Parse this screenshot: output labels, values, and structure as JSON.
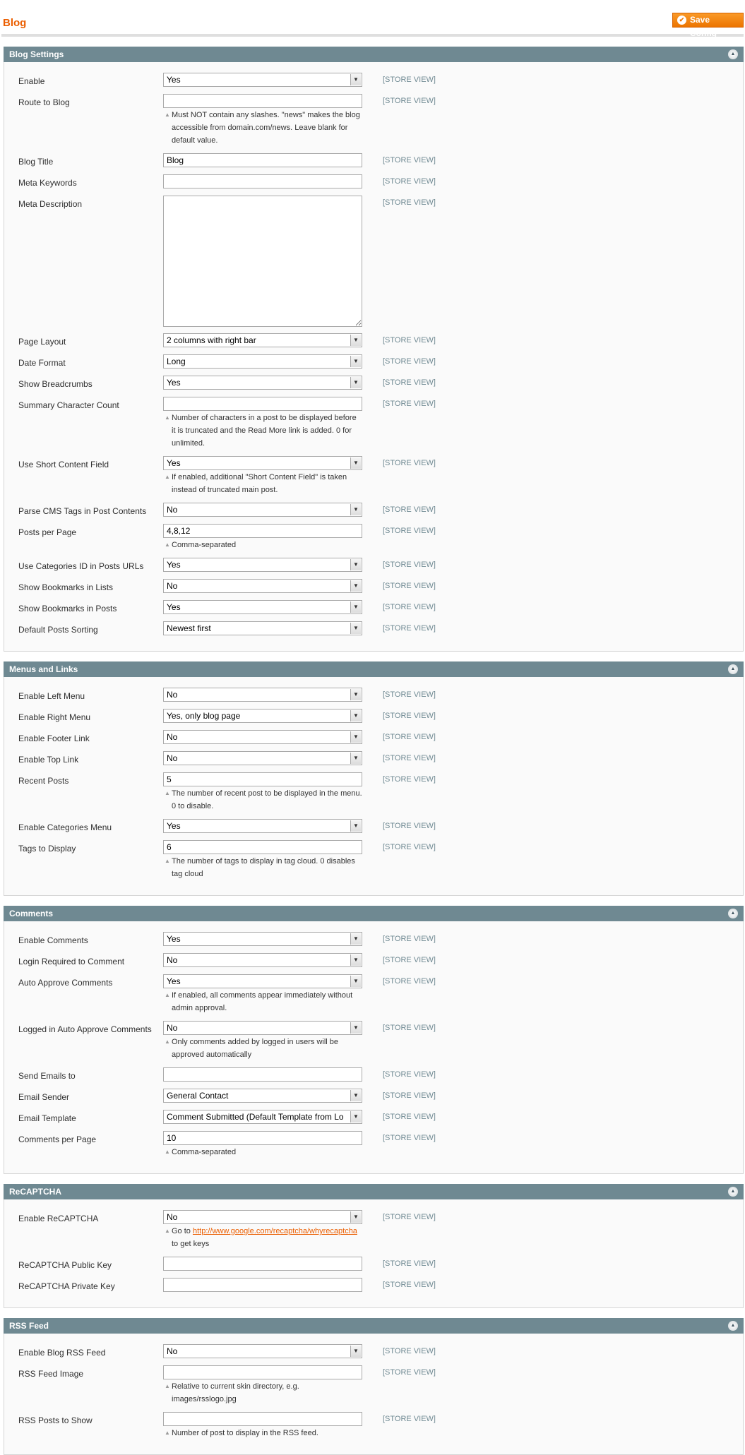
{
  "header": {
    "title": "Blog",
    "save_label": "Save Config"
  },
  "colors": {
    "accent": "#eb5e00",
    "section_header": "#6f8992",
    "button": "#f18200"
  },
  "sections": [
    {
      "title": "Blog Settings",
      "fields": [
        {
          "label": "Enable",
          "type": "select",
          "value": "Yes",
          "scope": "[STORE VIEW]"
        },
        {
          "label": "Route to Blog",
          "type": "text",
          "value": "",
          "scope": "[STORE VIEW]",
          "hint": "Must NOT contain any slashes. \"news\" makes the blog accessible from domain.com/news. Leave blank for default value."
        },
        {
          "label": "Blog Title",
          "type": "text",
          "value": "Blog",
          "scope": "[STORE VIEW]"
        },
        {
          "label": "Meta Keywords",
          "type": "text",
          "value": "",
          "scope": "[STORE VIEW]"
        },
        {
          "label": "Meta Description",
          "type": "textarea",
          "value": "",
          "scope": "[STORE VIEW]"
        },
        {
          "label": "Page Layout",
          "type": "select",
          "value": "2 columns with right bar",
          "scope": "[STORE VIEW]"
        },
        {
          "label": "Date Format",
          "type": "select",
          "value": "Long",
          "scope": "[STORE VIEW]"
        },
        {
          "label": "Show Breadcrumbs",
          "type": "select",
          "value": "Yes",
          "scope": "[STORE VIEW]"
        },
        {
          "label": "Summary Character Count",
          "type": "text",
          "value": "",
          "scope": "[STORE VIEW]",
          "hint": "Number of characters in a post to be displayed before it is truncated and the Read More link is added. 0 for unlimited."
        },
        {
          "label": "Use Short Content Field",
          "type": "select",
          "value": "Yes",
          "scope": "[STORE VIEW]",
          "hint": "If enabled, additional \"Short Content Field\" is taken instead of truncated main post."
        },
        {
          "label": "Parse CMS Tags in Post Contents",
          "type": "select",
          "value": "No",
          "scope": "[STORE VIEW]"
        },
        {
          "label": "Posts per Page",
          "type": "text",
          "value": "4,8,12",
          "scope": "[STORE VIEW]",
          "hint": "Comma-separated"
        },
        {
          "label": "Use Categories ID in Posts URLs",
          "type": "select",
          "value": "Yes",
          "scope": "[STORE VIEW]"
        },
        {
          "label": "Show Bookmarks in Lists",
          "type": "select",
          "value": "No",
          "scope": "[STORE VIEW]"
        },
        {
          "label": "Show Bookmarks in Posts",
          "type": "select",
          "value": "Yes",
          "scope": "[STORE VIEW]"
        },
        {
          "label": "Default Posts Sorting",
          "type": "select",
          "value": "Newest first",
          "scope": "[STORE VIEW]"
        }
      ]
    },
    {
      "title": "Menus and Links",
      "fields": [
        {
          "label": "Enable Left Menu",
          "type": "select",
          "value": "No",
          "scope": "[STORE VIEW]"
        },
        {
          "label": "Enable Right Menu",
          "type": "select",
          "value": "Yes, only blog page",
          "scope": "[STORE VIEW]"
        },
        {
          "label": "Enable Footer Link",
          "type": "select",
          "value": "No",
          "scope": "[STORE VIEW]"
        },
        {
          "label": "Enable Top Link",
          "type": "select",
          "value": "No",
          "scope": "[STORE VIEW]"
        },
        {
          "label": "Recent Posts",
          "type": "text",
          "value": "5",
          "scope": "[STORE VIEW]",
          "hint": "The number of recent post to be displayed in the menu. 0 to disable."
        },
        {
          "label": "Enable Categories Menu",
          "type": "select",
          "value": "Yes",
          "scope": "[STORE VIEW]"
        },
        {
          "label": "Tags to Display",
          "type": "text",
          "value": "6",
          "scope": "[STORE VIEW]",
          "hint": "The number of tags to display in tag cloud. 0 disables tag cloud"
        }
      ]
    },
    {
      "title": "Comments",
      "fields": [
        {
          "label": "Enable Comments",
          "type": "select",
          "value": "Yes",
          "scope": "[STORE VIEW]"
        },
        {
          "label": "Login Required to Comment",
          "type": "select",
          "value": "No",
          "scope": "[STORE VIEW]"
        },
        {
          "label": "Auto Approve Comments",
          "type": "select",
          "value": "Yes",
          "scope": "[STORE VIEW]",
          "hint": "If enabled, all comments appear immediately without admin approval."
        },
        {
          "label": "Logged in Auto Approve Comments",
          "type": "select",
          "value": "No",
          "scope": "[STORE VIEW]",
          "hint": "Only comments added by logged in users will be approved automatically"
        },
        {
          "label": "Send Emails to",
          "type": "text",
          "value": "",
          "scope": "[STORE VIEW]"
        },
        {
          "label": "Email Sender",
          "type": "select",
          "value": "General Contact",
          "scope": "[STORE VIEW]"
        },
        {
          "label": "Email Template",
          "type": "select",
          "value": "Comment Submitted (Default Template from Lo",
          "scope": "[STORE VIEW]"
        },
        {
          "label": "Comments per Page",
          "type": "text",
          "value": "10",
          "scope": "[STORE VIEW]",
          "hint": "Comma-separated"
        }
      ]
    },
    {
      "title": "ReCAPTCHA",
      "fields": [
        {
          "label": "Enable ReCAPTCHA",
          "type": "select",
          "value": "No",
          "scope": "[STORE VIEW]",
          "hint": "Go to",
          "hint_link": "http://www.google.com/recaptcha/whyrecaptcha",
          "hint_suffix": "to get keys"
        },
        {
          "label": "ReCAPTCHA Public Key",
          "type": "text",
          "value": "",
          "scope": "[STORE VIEW]"
        },
        {
          "label": "ReCAPTCHA Private Key",
          "type": "text",
          "value": "",
          "scope": "[STORE VIEW]"
        }
      ]
    },
    {
      "title": "RSS Feed",
      "fields": [
        {
          "label": "Enable Blog RSS Feed",
          "type": "select",
          "value": "No",
          "scope": "[STORE VIEW]"
        },
        {
          "label": "RSS Feed Image",
          "type": "text",
          "value": "",
          "scope": "[STORE VIEW]",
          "hint": "Relative to current skin directory, e.g. images/rsslogo.jpg"
        },
        {
          "label": "RSS Posts to Show",
          "type": "text",
          "value": "",
          "scope": "[STORE VIEW]",
          "hint": "Number of post to display in the RSS feed."
        }
      ]
    }
  ]
}
